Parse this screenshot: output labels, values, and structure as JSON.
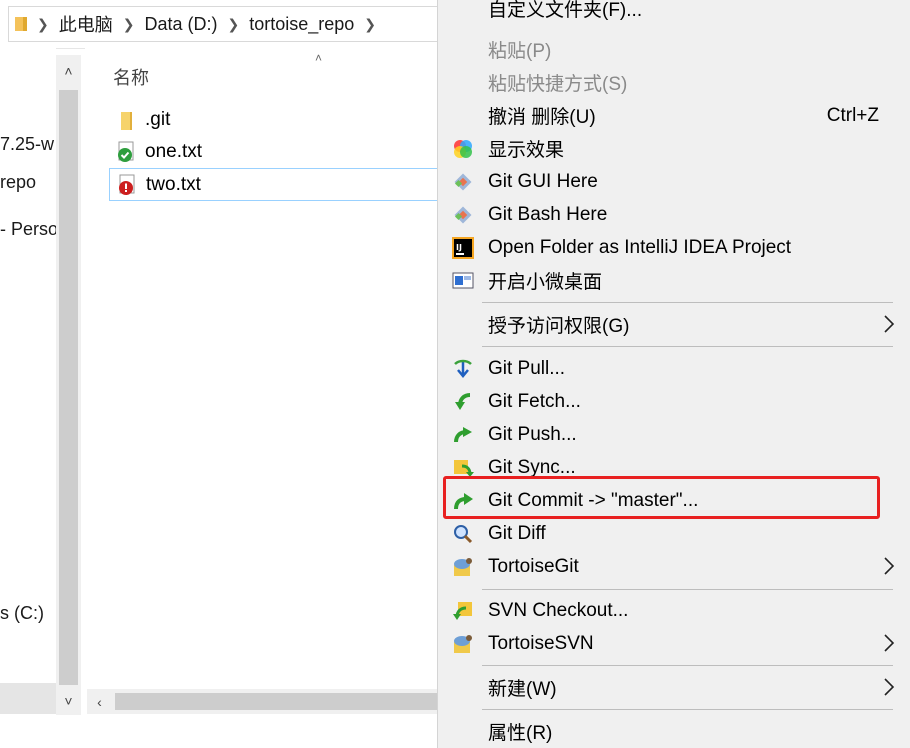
{
  "address_bar": {
    "crumbs": [
      "此电脑",
      "Data (D:)",
      "tortoise_repo"
    ]
  },
  "nav_pane": {
    "items": [
      "7.25-w",
      "repo",
      "- Perso",
      "s (C:)"
    ]
  },
  "file_list": {
    "column_header": "名称",
    "files": [
      {
        "name": ".git",
        "icon": "folder-icon"
      },
      {
        "name": "one.txt",
        "icon": "text-file-ok-icon"
      },
      {
        "name": "two.txt",
        "icon": "text-file-modified-icon"
      }
    ]
  },
  "context_menu": {
    "items": [
      {
        "label": "自定义文件夹(F)...",
        "enabled": true
      },
      {
        "label": "粘贴(P)",
        "enabled": false
      },
      {
        "label": "粘贴快捷方式(S)",
        "enabled": false
      },
      {
        "label": "撤消 删除(U)",
        "shortcut": "Ctrl+Z",
        "enabled": true
      },
      {
        "label": "显示效果",
        "icon": "color-wheel-icon"
      },
      {
        "label": "Git GUI Here",
        "icon": "git-icon"
      },
      {
        "label": "Git Bash Here",
        "icon": "git-icon"
      },
      {
        "label": "Open Folder as IntelliJ IDEA Project",
        "icon": "intellij-icon"
      },
      {
        "label": "开启小微桌面",
        "icon": "desktop-icon"
      },
      {
        "label": "授予访问权限(G)",
        "submenu": true
      },
      {
        "label": "Git Pull...",
        "icon": "git-pull-icon"
      },
      {
        "label": "Git Fetch...",
        "icon": "git-fetch-icon"
      },
      {
        "label": "Git Push...",
        "icon": "git-push-icon"
      },
      {
        "label": "Git Sync...",
        "icon": "git-sync-icon"
      },
      {
        "label": "Git Commit -> \"master\"...",
        "icon": "git-commit-icon",
        "highlighted": true
      },
      {
        "label": "Git Diff",
        "icon": "magnifier-icon"
      },
      {
        "label": "TortoiseGit",
        "icon": "tortoisegit-icon",
        "submenu": true
      },
      {
        "label": "SVN Checkout...",
        "icon": "svn-checkout-icon"
      },
      {
        "label": "TortoiseSVN",
        "icon": "tortoisesvn-icon",
        "submenu": true
      },
      {
        "label": "新建(W)",
        "submenu": true
      },
      {
        "label": "属性(R)"
      }
    ]
  },
  "colors": {
    "highlight_border": "#e82020",
    "menu_bg": "#f0f0f0",
    "selection_border": "#99d1ff"
  }
}
